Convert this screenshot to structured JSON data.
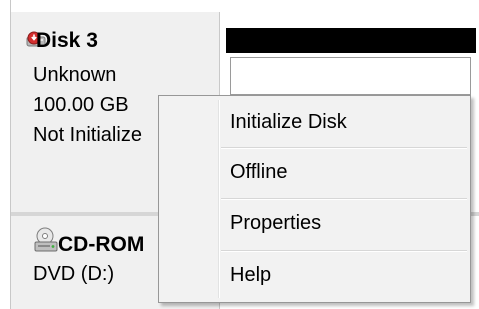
{
  "disk": {
    "title": "Disk 3",
    "type": "Unknown",
    "size": "100.00 GB",
    "status": "Not Initialize",
    "icon": "disk-error-icon"
  },
  "cdrom": {
    "title": "CD-ROM",
    "drive": "DVD (D:)",
    "icon": "cdrom-icon"
  },
  "context_menu": {
    "items": [
      {
        "label": "Initialize Disk"
      },
      {
        "label": "Offline"
      },
      {
        "label": "Properties"
      },
      {
        "label": "Help"
      }
    ]
  },
  "colors": {
    "partition_header": "#000000",
    "info_panel_bg": "#f0f0f0",
    "menu_bg": "#f2f2f2",
    "error_red": "#d32f2f"
  }
}
